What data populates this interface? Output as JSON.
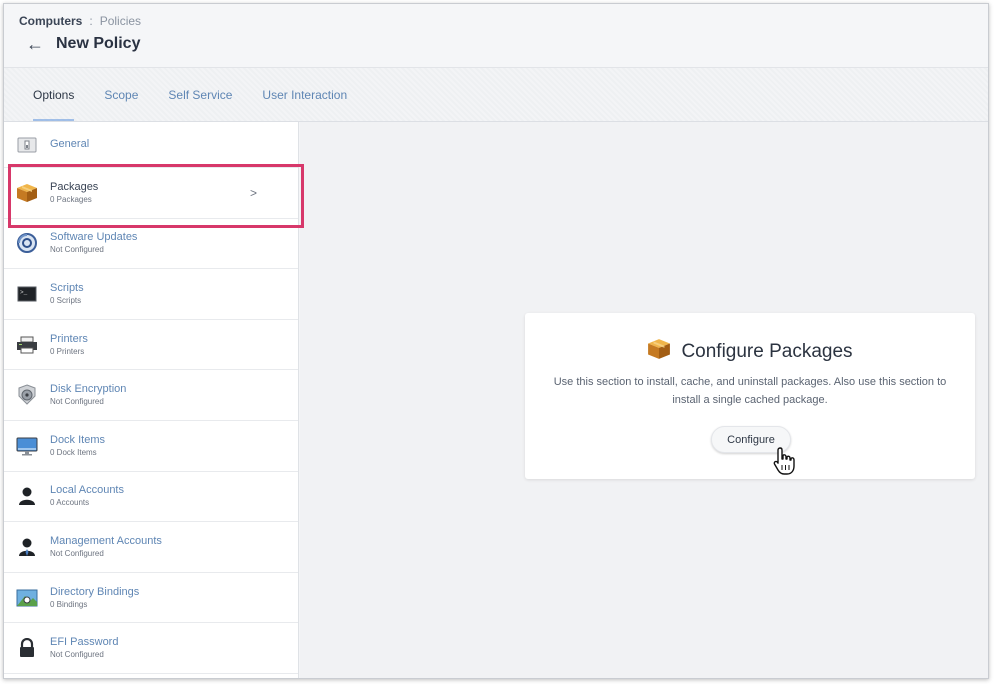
{
  "breadcrumb": {
    "root": "Computers",
    "separator": ":",
    "current": "Policies"
  },
  "page": {
    "title": "New Policy",
    "back_icon": "left-arrow-icon"
  },
  "tabs": [
    {
      "label": "Options",
      "active": true
    },
    {
      "label": "Scope",
      "active": false
    },
    {
      "label": "Self Service",
      "active": false
    },
    {
      "label": "User Interaction",
      "active": false
    }
  ],
  "sidebar": {
    "items": [
      {
        "label": "General",
        "sub": "",
        "icon": "general-settings-icon"
      },
      {
        "label": "Packages",
        "sub": "0 Packages",
        "icon": "package-box-icon",
        "selected": true
      },
      {
        "label": "Software Updates",
        "sub": "Not Configured",
        "icon": "software-update-icon"
      },
      {
        "label": "Scripts",
        "sub": "0 Scripts",
        "icon": "terminal-icon"
      },
      {
        "label": "Printers",
        "sub": "0 Printers",
        "icon": "printer-icon"
      },
      {
        "label": "Disk Encryption",
        "sub": "Not Configured",
        "icon": "disk-encryption-icon"
      },
      {
        "label": "Dock Items",
        "sub": "0 Dock Items",
        "icon": "monitor-icon"
      },
      {
        "label": "Local Accounts",
        "sub": "0 Accounts",
        "icon": "user-icon"
      },
      {
        "label": "Management Accounts",
        "sub": "Not Configured",
        "icon": "admin-user-icon"
      },
      {
        "label": "Directory Bindings",
        "sub": "0 Bindings",
        "icon": "directory-icon"
      },
      {
        "label": "EFI Password",
        "sub": "Not Configured",
        "icon": "lock-icon"
      }
    ],
    "selected_chevron": ">"
  },
  "card": {
    "title": "Configure Packages",
    "description": "Use this section to install, cache, and uninstall packages. Also use this section to install a single cached package.",
    "button_label": "Configure"
  },
  "colors": {
    "highlight": "#d7386a",
    "link": "#5f86b4",
    "tab_underline": "#3f7ed8"
  }
}
